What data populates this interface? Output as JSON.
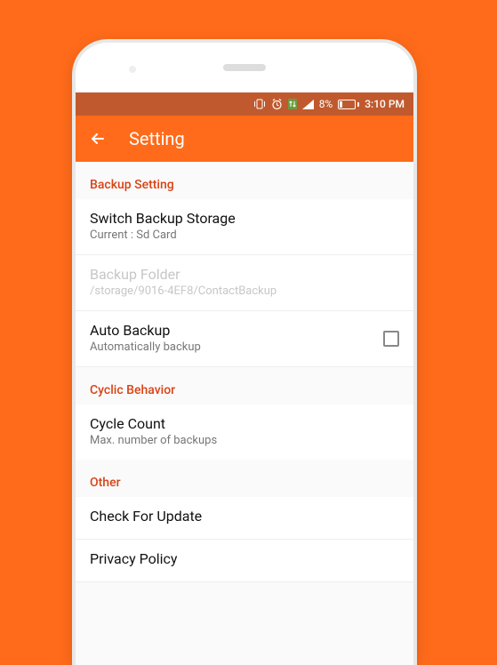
{
  "status": {
    "battery_pct": "8%",
    "time": "3:10 PM"
  },
  "header": {
    "title": "Setting"
  },
  "sections": {
    "backup": {
      "header": "Backup Setting",
      "switch_storage": {
        "title": "Switch Backup Storage",
        "sub": "Current : Sd Card"
      },
      "folder": {
        "title": "Backup Folder",
        "sub": "/storage/9016-4EF8/ContactBackup"
      },
      "auto_backup": {
        "title": "Auto Backup",
        "sub": "Automatically backup"
      }
    },
    "cyclic": {
      "header": "Cyclic Behavior",
      "cycle_count": {
        "title": "Cycle Count",
        "sub": "Max. number of backups"
      }
    },
    "other": {
      "header": "Other",
      "check_update": {
        "title": "Check For Update"
      },
      "privacy": {
        "title": "Privacy Policy"
      }
    }
  }
}
